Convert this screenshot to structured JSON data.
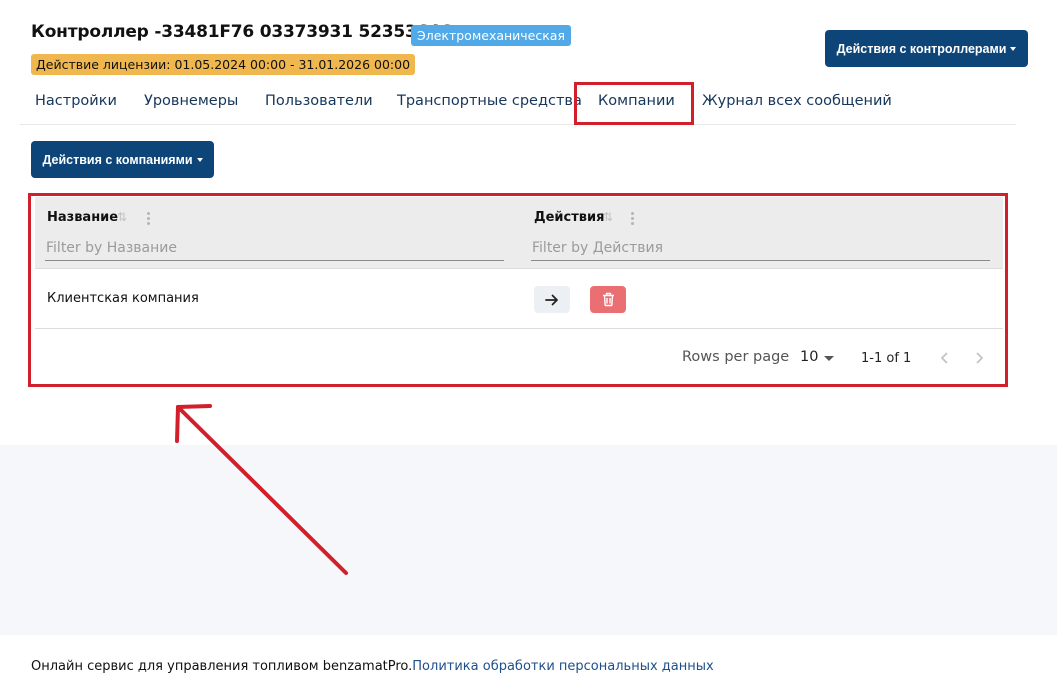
{
  "header": {
    "title": "Контроллер -33481F76 03373931 5235364C",
    "type_badge": "Электромеханическая",
    "license_badge": "Действие лицензии: 01.05.2024 00:00 - 31.01.2026 00:00",
    "controller_actions_label": "Действия с контроллерами"
  },
  "tabs": [
    {
      "label": "Настройки"
    },
    {
      "label": "Уровнемеры"
    },
    {
      "label": "Пользователи"
    },
    {
      "label": "Транспортные средства"
    },
    {
      "label": "Компании",
      "active": true
    },
    {
      "label": "Журнал всех сообщений"
    }
  ],
  "companies": {
    "actions_label": "Действия с компаниями",
    "columns": [
      {
        "header": "Название",
        "filter_placeholder": "Filter by Название"
      },
      {
        "header": "Действия",
        "filter_placeholder": "Filter by Действия"
      }
    ],
    "rows": [
      {
        "name": "Клиентская компания"
      }
    ],
    "pagination": {
      "rows_per_page_label": "Rows per page",
      "rows_per_page_value": "10",
      "range": "1-1 of 1"
    }
  },
  "footer": {
    "text": "Онлайн сервис для управления топливом benzamatPro.",
    "link": "Политика обработки персональных данных"
  },
  "colors": {
    "primary": "#0d4579",
    "type_badge": "#52a9e8",
    "license_badge": "#f0b74f",
    "delete": "#ea6f73",
    "annotation": "#d11f2b"
  },
  "icons": {
    "go": "arrow-right-icon",
    "delete": "trash-icon",
    "sort": "sort-icon",
    "column_menu": "kebab-menu-icon",
    "prev": "chevron-left-icon",
    "next": "chevron-right-icon"
  }
}
